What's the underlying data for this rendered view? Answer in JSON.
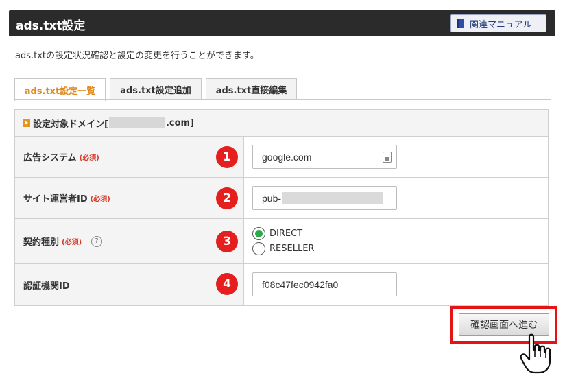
{
  "header": {
    "title": "ads.txt設定",
    "manual_button": "関連マニュアル",
    "manual_icon": "book-icon"
  },
  "intro_text": "ads.txtの設定状況確認と設定の変更を行うことができます。",
  "tabs": [
    {
      "label": "ads.txt設定一覧",
      "active": true
    },
    {
      "label": "ads.txt設定追加",
      "active": false
    },
    {
      "label": "ads.txt直接編集",
      "active": false
    }
  ],
  "domain": {
    "prefix": "設定対象ドメイン[",
    "suffix": ".com]"
  },
  "form": {
    "required_tag": "(必須)",
    "rows": [
      {
        "number": "1",
        "label": "広告システム",
        "value": "google.com"
      },
      {
        "number": "2",
        "label": "サイト運営者ID",
        "value": "pub-"
      },
      {
        "number": "3",
        "label": "契約種別",
        "help": "?"
      },
      {
        "number": "4",
        "label": "認証機関ID",
        "value": "f08c47fec0942fa0"
      }
    ],
    "contract_options": [
      {
        "label": "DIRECT",
        "selected": true
      },
      {
        "label": "RESELLER",
        "selected": false
      }
    ]
  },
  "confirm_button": "確認画面へ進む",
  "colors": {
    "header_bg": "#2b2b2b",
    "active_tab": "#e08a1c",
    "badge": "#e51e1e",
    "highlight": "#e51313",
    "radio_checked": "#2ea94a"
  }
}
